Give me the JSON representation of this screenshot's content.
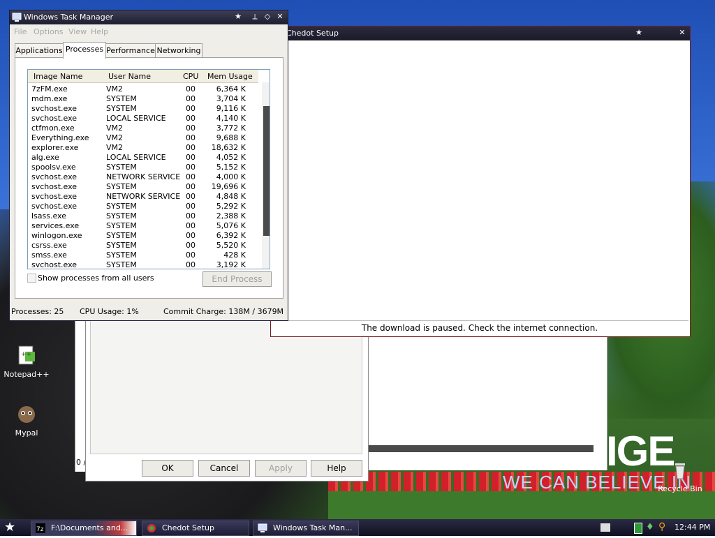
{
  "desktop": {
    "icons": [
      {
        "label": "Notepad++"
      },
      {
        "label": "Mypal"
      },
      {
        "label": "Recycle Bin"
      }
    ],
    "slogan_big": "IGE",
    "slogan_small": "WE CAN BELIEVE IN"
  },
  "back_dialog": {
    "buttons": {
      "ok": "OK",
      "cancel": "Cancel",
      "apply": "Apply",
      "help": "Help"
    },
    "side_text": "0 /"
  },
  "chedot": {
    "title": "Chedot Setup",
    "status": "The download is paused. Check the internet connection."
  },
  "task_manager": {
    "title": "Windows Task Manager",
    "menu": {
      "file": "File",
      "options": "Options",
      "view": "View",
      "help": "Help"
    },
    "tabs": {
      "applications": "Applications",
      "processes": "Processes",
      "performance": "Performance",
      "networking": "Networking"
    },
    "columns": {
      "image": "Image Name",
      "user": "User Name",
      "cpu": "CPU",
      "mem": "Mem Usage"
    },
    "rows": [
      {
        "image": "7zFM.exe",
        "user": "VM2",
        "cpu": "00",
        "mem": "6,364 K"
      },
      {
        "image": "mdm.exe",
        "user": "SYSTEM",
        "cpu": "00",
        "mem": "3,704 K"
      },
      {
        "image": "svchost.exe",
        "user": "SYSTEM",
        "cpu": "00",
        "mem": "9,116 K"
      },
      {
        "image": "svchost.exe",
        "user": "LOCAL SERVICE",
        "cpu": "00",
        "mem": "4,140 K"
      },
      {
        "image": "ctfmon.exe",
        "user": "VM2",
        "cpu": "00",
        "mem": "3,772 K"
      },
      {
        "image": "Everything.exe",
        "user": "VM2",
        "cpu": "00",
        "mem": "9,688 K"
      },
      {
        "image": "explorer.exe",
        "user": "VM2",
        "cpu": "00",
        "mem": "18,632 K"
      },
      {
        "image": "alg.exe",
        "user": "LOCAL SERVICE",
        "cpu": "00",
        "mem": "4,052 K"
      },
      {
        "image": "spoolsv.exe",
        "user": "SYSTEM",
        "cpu": "00",
        "mem": "5,152 K"
      },
      {
        "image": "svchost.exe",
        "user": "NETWORK SERVICE",
        "cpu": "00",
        "mem": "4,000 K"
      },
      {
        "image": "svchost.exe",
        "user": "SYSTEM",
        "cpu": "00",
        "mem": "19,696 K"
      },
      {
        "image": "svchost.exe",
        "user": "NETWORK SERVICE",
        "cpu": "00",
        "mem": "4,848 K"
      },
      {
        "image": "svchost.exe",
        "user": "SYSTEM",
        "cpu": "00",
        "mem": "5,292 K"
      },
      {
        "image": "lsass.exe",
        "user": "SYSTEM",
        "cpu": "00",
        "mem": "2,388 K"
      },
      {
        "image": "services.exe",
        "user": "SYSTEM",
        "cpu": "00",
        "mem": "5,076 K"
      },
      {
        "image": "winlogon.exe",
        "user": "SYSTEM",
        "cpu": "00",
        "mem": "6,392 K"
      },
      {
        "image": "csrss.exe",
        "user": "SYSTEM",
        "cpu": "00",
        "mem": "5,520 K"
      },
      {
        "image": "smss.exe",
        "user": "SYSTEM",
        "cpu": "00",
        "mem": "428 K"
      },
      {
        "image": "svchost.exe",
        "user": "SYSTEM",
        "cpu": "00",
        "mem": "3,192 K"
      }
    ],
    "show_all_label": "Show processes from all users",
    "end_process_label": "End Process",
    "status": {
      "processes": "Processes: 25",
      "cpu": "CPU Usage: 1%",
      "commit": "Commit Charge: 138M / 3679M"
    }
  },
  "taskbar": {
    "buttons": [
      {
        "label": "F:\\Documents and..."
      },
      {
        "label": "Chedot Setup"
      },
      {
        "label": "Windows Task Man..."
      }
    ],
    "clock": "12:44 PM"
  },
  "colors": {
    "titlebar": "#1e1e30",
    "chedot_border": "#7a1c1c",
    "scroll_thumb": "#4a4a4a"
  }
}
